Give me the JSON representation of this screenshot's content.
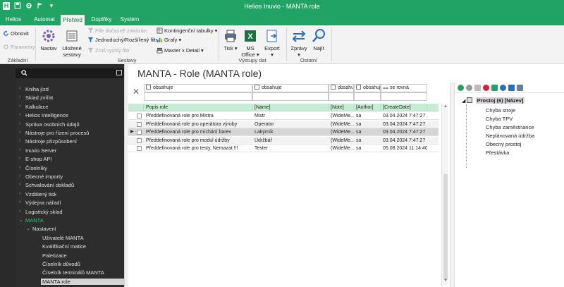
{
  "window": {
    "title": "Helios Inuvio - MANTA role",
    "quick_access": [
      "H",
      "save-icon",
      "settings-icon",
      "flag-icon",
      "dropdown-icon"
    ]
  },
  "tabs": [
    {
      "label": "Helios",
      "active": false
    },
    {
      "label": "Automat",
      "active": false
    },
    {
      "label": "Přehled",
      "active": true
    },
    {
      "label": "Doplňky",
      "active": false
    },
    {
      "label": "Systém",
      "active": false
    }
  ],
  "ribbon": {
    "basic": {
      "refresh": "Obnovit",
      "parameters": "Parametry",
      "group_label": "Základní"
    },
    "views": {
      "settings": "Nastav",
      "saved_views": [
        "Uložené",
        "sestavy"
      ],
      "filter_temp": "Filtr dočasně zakázán",
      "simple_filter": "Jednoduchý/Rozšířený filtr",
      "cancel_quick_filter": "Zruš rychlý filtr",
      "pivot": "Kontingenční tabulky",
      "graphs": "Grafy",
      "master_detail": "Master x Detail",
      "group_label": "Sestavy"
    },
    "output": {
      "print": "Tisk",
      "ms_office": [
        "MS",
        "Office"
      ],
      "export": "Export",
      "group_label": "Výstupy dat"
    },
    "other": {
      "messages": "Zprávy",
      "find": "Najít",
      "group_label": "Ostatní"
    }
  },
  "nav": {
    "items": [
      {
        "label": "Kniha jízd",
        "arrow": "›"
      },
      {
        "label": "Sklad zvířat",
        "arrow": "›"
      },
      {
        "label": "Kalkulace",
        "arrow": "›"
      },
      {
        "label": "Helios Intelligence",
        "arrow": "›"
      },
      {
        "label": "Správa osobních údajů",
        "arrow": "›"
      },
      {
        "label": "Nástroje pro řízení procesů",
        "arrow": "›"
      },
      {
        "label": "Nástroje přizpůsobení",
        "arrow": "›"
      },
      {
        "label": "Inuvio Server",
        "arrow": "›"
      },
      {
        "label": "E-shop API",
        "arrow": "›"
      },
      {
        "label": "Číselníky",
        "arrow": "›"
      },
      {
        "label": "Obecné importy",
        "arrow": "›"
      },
      {
        "label": "Schvalování dokladů",
        "arrow": "›"
      },
      {
        "label": "Vzdálený tisk",
        "arrow": "›"
      },
      {
        "label": "Výdejna nářadí",
        "arrow": "›"
      },
      {
        "label": "Logistický sklad",
        "arrow": "›"
      },
      {
        "label": "MANTA",
        "arrow": "⌄"
      }
    ],
    "sub_group": {
      "label": "Nastavení",
      "arrow": "⌄"
    },
    "sub_items": [
      {
        "label": "Uživatelé MANTA"
      },
      {
        "label": "Kvalifikační matice"
      },
      {
        "label": "Paletizace"
      },
      {
        "label": "Číselník důvodů"
      },
      {
        "label": "Číselník terminálů MANTA"
      },
      {
        "label": "MANTA role"
      }
    ]
  },
  "main": {
    "title": "MANTA - Role (MANTA role)",
    "filters": [
      "obsahuje",
      "obsahuje",
      "obsahuje",
      "obsahuje",
      "se rovná"
    ],
    "columns": [
      "Popis role",
      "[Name]",
      "[Note]",
      "[Author]",
      "[CreateDate]"
    ],
    "rows": [
      {
        "desc": "Předdefinovaná role pro Mistra",
        "name": "Mistr",
        "note": "(WideMe...",
        "author": "sa",
        "date": "03.04.2024 7:47:27"
      },
      {
        "desc": "Předdefinovaná role pro operátora výroby",
        "name": "Operator",
        "note": "(WideMe...",
        "author": "sa",
        "date": "03.04.2024 7:47:27"
      },
      {
        "desc": "Předdefinovaná role pro míchání barev",
        "name": "Lakýrník",
        "note": "(WideMe...",
        "author": "sa",
        "date": "03.04.2024 7:47:27"
      },
      {
        "desc": "Předdefinovaná role pro modul údržby",
        "name": "Údržbář",
        "note": "(WideMe...",
        "author": "sa",
        "date": "03.04.2024 7:47:27"
      },
      {
        "desc": "Předdefinovaná role pro testy. Nemazat !!!",
        "name": "Tester",
        "note": "(WideMe...",
        "author": "sa",
        "date": "05.08.2024 11:14:40"
      }
    ]
  },
  "tree": {
    "root": "Prostoj (6) [Název]",
    "items": [
      "Chyba stroje",
      "Chyba TPV",
      "Chyba zaměstnance",
      "Neplánovaná údržba",
      "Obecný prostoj",
      "Přestávka"
    ]
  },
  "colors": {
    "brand_green": "#21a366",
    "header_green": "#c8ecd6",
    "nav_bg": "#2d2d2d",
    "nav_active": "#2ecc71"
  }
}
